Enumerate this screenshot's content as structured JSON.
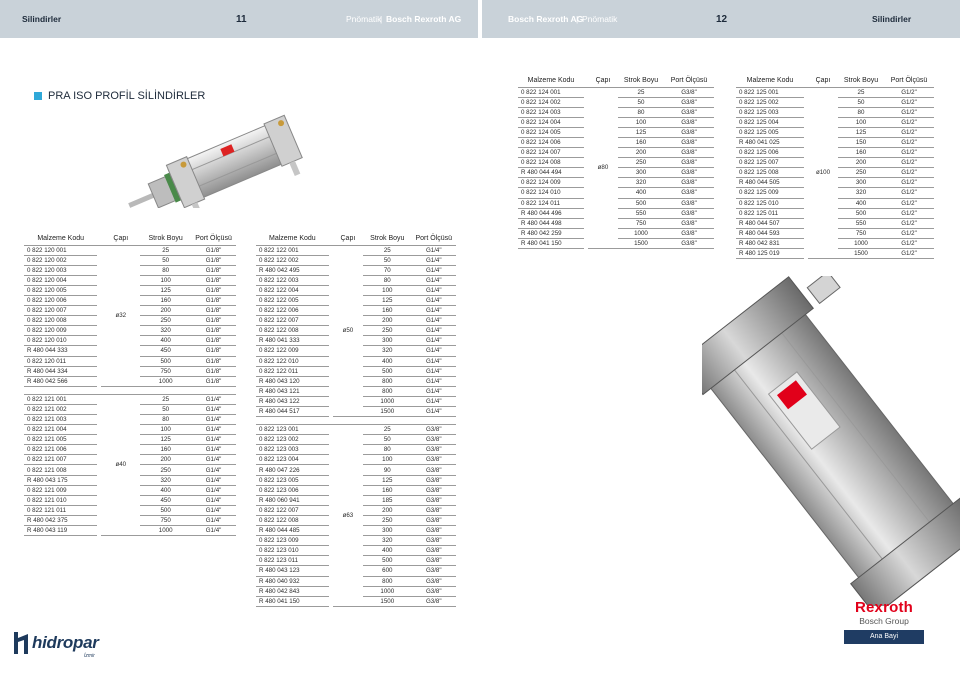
{
  "header_left": {
    "title": "Silindirler",
    "page": "11",
    "category": "Pnömatik",
    "brand": "Bosch Rexroth AG"
  },
  "header_right": {
    "brand": "Bosch Rexroth AG",
    "category": "Pnömatik",
    "page": "12",
    "title": "Silindirler"
  },
  "section_title": "PRA ISO PROFİL SİLİNDİRLER",
  "columns": {
    "code": "Malzeme Kodu",
    "dia": "Çapı",
    "stroke": "Strok Boyu",
    "port": "Port Ölçüsü"
  },
  "tables": {
    "t1": {
      "groups": [
        {
          "dia": "ø32",
          "rows": [
            [
              "0 822 120 001",
              "25",
              "G1/8\""
            ],
            [
              "0 822 120 002",
              "50",
              "G1/8\""
            ],
            [
              "0 822 120 003",
              "80",
              "G1/8\""
            ],
            [
              "0 822 120 004",
              "100",
              "G1/8\""
            ],
            [
              "0 822 120 005",
              "125",
              "G1/8\""
            ],
            [
              "0 822 120 006",
              "160",
              "G1/8\""
            ],
            [
              "0 822 120 007",
              "200",
              "G1/8\""
            ],
            [
              "0 822 120 008",
              "250",
              "G1/8\""
            ],
            [
              "0 822 120 009",
              "320",
              "G1/8\""
            ],
            [
              "0 822 120 010",
              "400",
              "G1/8\""
            ],
            [
              "R 480 044 333",
              "450",
              "G1/8\""
            ],
            [
              "0 822 120 011",
              "500",
              "G1/8\""
            ],
            [
              "R 480 044 334",
              "750",
              "G1/8\""
            ],
            [
              "R 480 042 566",
              "1000",
              "G1/8\""
            ]
          ]
        },
        {
          "dia": "ø40",
          "rows": [
            [
              "0 822 121 001",
              "25",
              "G1/4\""
            ],
            [
              "0 822 121 002",
              "50",
              "G1/4\""
            ],
            [
              "0 822 121 003",
              "80",
              "G1/4\""
            ],
            [
              "0 822 121 004",
              "100",
              "G1/4\""
            ],
            [
              "0 822 121 005",
              "125",
              "G1/4\""
            ],
            [
              "0 822 121 006",
              "160",
              "G1/4\""
            ],
            [
              "0 822 121 007",
              "200",
              "G1/4\""
            ],
            [
              "0 822 121 008",
              "250",
              "G1/4\""
            ],
            [
              "R 480 043 175",
              "320",
              "G1/4\""
            ],
            [
              "0 822 121 009",
              "400",
              "G1/4\""
            ],
            [
              "0 822 121 010",
              "450",
              "G1/4\""
            ],
            [
              "0 822 121 011",
              "500",
              "G1/4\""
            ],
            [
              "R 480 042 375",
              "750",
              "G1/4\""
            ],
            [
              "R 480 043 119",
              "1000",
              "G1/4\""
            ]
          ]
        }
      ]
    },
    "t2": {
      "groups": [
        {
          "dia": "ø50",
          "rows": [
            [
              "0 822 122 001",
              "25",
              "G1/4\""
            ],
            [
              "0 822 122 002",
              "50",
              "G1/4\""
            ],
            [
              "R 480 042 495",
              "70",
              "G1/4\""
            ],
            [
              "0 822 122 003",
              "80",
              "G1/4\""
            ],
            [
              "0 822 122 004",
              "100",
              "G1/4\""
            ],
            [
              "0 822 122 005",
              "125",
              "G1/4\""
            ],
            [
              "0 822 122 006",
              "160",
              "G1/4\""
            ],
            [
              "0 822 122 007",
              "200",
              "G1/4\""
            ],
            [
              "0 822 122 008",
              "250",
              "G1/4\""
            ],
            [
              "R 480 041 333",
              "300",
              "G1/4\""
            ],
            [
              "0 822 122 009",
              "320",
              "G1/4\""
            ],
            [
              "0 822 122 010",
              "400",
              "G1/4\""
            ],
            [
              "0 822 122 011",
              "500",
              "G1/4\""
            ],
            [
              "R 480 043 120",
              "800",
              "G1/4\""
            ],
            [
              "R 480 043 121",
              "800",
              "G1/4\""
            ],
            [
              "R 480 043 122",
              "1000",
              "G1/4\""
            ],
            [
              "R 480 044 517",
              "1500",
              "G1/4\""
            ]
          ]
        },
        {
          "dia": "ø63",
          "rows": [
            [
              "0 822 123 001",
              "25",
              "G3/8\""
            ],
            [
              "0 822 123 002",
              "50",
              "G3/8\""
            ],
            [
              "0 822 123 003",
              "80",
              "G3/8\""
            ],
            [
              "0 822 123 004",
              "100",
              "G3/8\""
            ],
            [
              "R 480 047 226",
              "90",
              "G3/8\""
            ],
            [
              "0 822 123 005",
              "125",
              "G3/8\""
            ],
            [
              "0 822 123 006",
              "160",
              "G3/8\""
            ],
            [
              "R 480 060 941",
              "185",
              "G3/8\""
            ],
            [
              "0 822 122 007",
              "200",
              "G3/8\""
            ],
            [
              "0 822 122 008",
              "250",
              "G3/8\""
            ],
            [
              "R 480 044 485",
              "300",
              "G3/8\""
            ],
            [
              "0 822 123 009",
              "320",
              "G3/8\""
            ],
            [
              "0 822 123 010",
              "400",
              "G3/8\""
            ],
            [
              "0 822 123 011",
              "500",
              "G3/8\""
            ],
            [
              "R 480 043 123",
              "600",
              "G3/8\""
            ],
            [
              "R 480 040 932",
              "800",
              "G3/8\""
            ],
            [
              "R 480 042 843",
              "1000",
              "G3/8\""
            ],
            [
              "R 480 041 150",
              "1500",
              "G3/8\""
            ]
          ]
        }
      ]
    },
    "t3": {
      "groups": [
        {
          "dia": "ø80",
          "rows": [
            [
              "0 822 124 001",
              "25",
              "G3/8\""
            ],
            [
              "0 822 124 002",
              "50",
              "G3/8\""
            ],
            [
              "0 822 124 003",
              "80",
              "G3/8\""
            ],
            [
              "0 822 124 004",
              "100",
              "G3/8\""
            ],
            [
              "0 822 124 005",
              "125",
              "G3/8\""
            ],
            [
              "0 822 124 006",
              "160",
              "G3/8\""
            ],
            [
              "0 822 124 007",
              "200",
              "G3/8\""
            ],
            [
              "0 822 124 008",
              "250",
              "G3/8\""
            ],
            [
              "R 480 044 494",
              "300",
              "G3/8\""
            ],
            [
              "0 822 124 009",
              "320",
              "G3/8\""
            ],
            [
              "0 822 124 010",
              "400",
              "G3/8\""
            ],
            [
              "0 822 124 011",
              "500",
              "G3/8\""
            ],
            [
              "R 480 044 496",
              "550",
              "G3/8\""
            ],
            [
              "R 480 044 498",
              "750",
              "G3/8\""
            ],
            [
              "R 480 042 259",
              "1000",
              "G3/8\""
            ],
            [
              "R 480 041 150",
              "1500",
              "G3/8\""
            ]
          ]
        }
      ]
    },
    "t4": {
      "groups": [
        {
          "dia": "ø100",
          "rows": [
            [
              "0 822 125 001",
              "25",
              "G1/2\""
            ],
            [
              "0 822 125 002",
              "50",
              "G1/2\""
            ],
            [
              "0 822 125 003",
              "80",
              "G1/2\""
            ],
            [
              "0 822 125 004",
              "100",
              "G1/2\""
            ],
            [
              "0 822 125 005",
              "125",
              "G1/2\""
            ],
            [
              "R 480 041 025",
              "150",
              "G1/2\""
            ],
            [
              "0 822 125 006",
              "160",
              "G1/2\""
            ],
            [
              "0 822 125 007",
              "200",
              "G1/2\""
            ],
            [
              "0 822 125 008",
              "250",
              "G1/2\""
            ],
            [
              "R 480 044 505",
              "300",
              "G1/2\""
            ],
            [
              "0 822 125 009",
              "320",
              "G1/2\""
            ],
            [
              "0 822 125 010",
              "400",
              "G1/2\""
            ],
            [
              "0 822 125 011",
              "500",
              "G1/2\""
            ],
            [
              "R 480 044 507",
              "550",
              "G1/2\""
            ],
            [
              "R 480 044 593",
              "750",
              "G1/2\""
            ],
            [
              "R 480 042 831",
              "1000",
              "G1/2\""
            ],
            [
              "R 480 125 019",
              "1500",
              "G1/2\""
            ]
          ]
        }
      ]
    }
  },
  "logo_left": {
    "name": "hidropar",
    "sub": "İzmir"
  },
  "logo_right": {
    "brand": "Rexroth",
    "group": "Bosch Group",
    "badge": "Ana Bayi"
  },
  "colors": {
    "header_bg": "#c9d2d9",
    "accent": "#2fa8d8",
    "rexroth_red": "#e1001a",
    "navy": "#1f3c63"
  }
}
